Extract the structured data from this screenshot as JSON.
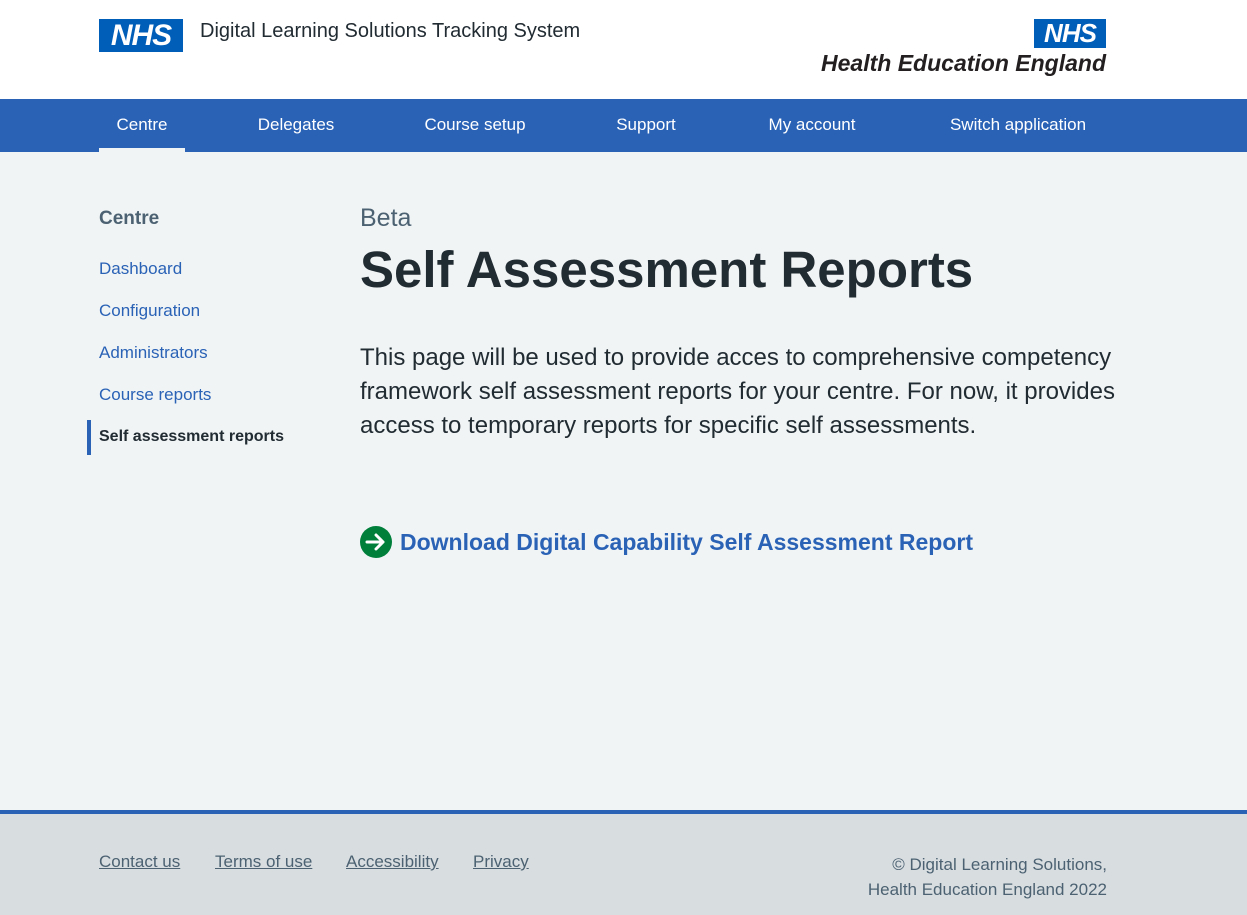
{
  "header": {
    "logo_text": "NHS",
    "service_name": "Digital Learning Solutions Tracking System",
    "partner_logo_badge": "NHS",
    "partner_logo_text": "Health Education England"
  },
  "nav": {
    "items": [
      {
        "label": "Centre",
        "active": true
      },
      {
        "label": "Delegates"
      },
      {
        "label": "Course setup"
      },
      {
        "label": "Support"
      },
      {
        "label": "My account"
      },
      {
        "label": "Switch application"
      }
    ]
  },
  "sidebar": {
    "heading": "Centre",
    "items": [
      {
        "label": "Dashboard"
      },
      {
        "label": "Configuration"
      },
      {
        "label": "Administrators"
      },
      {
        "label": "Course reports"
      },
      {
        "label": "Self assessment reports",
        "current": true
      }
    ]
  },
  "main": {
    "caption": "Beta",
    "title": "Self Assessment Reports",
    "body": "This page will be used to provide acces to comprehensive competency framework self assessment reports for your centre. For now, it provides access to temporary reports for specific self assessments.",
    "action_link": "Download Digital Capability Self Assessment Report",
    "action_icon": "arrow-right-circle-icon"
  },
  "footer": {
    "links": [
      {
        "label": "Contact us"
      },
      {
        "label": "Terms of use"
      },
      {
        "label": "Accessibility"
      },
      {
        "label": "Privacy"
      }
    ],
    "copyright_line1": "© Digital Learning Solutions,",
    "copyright_line2": "Health Education England 2022"
  },
  "colors": {
    "nhs_blue": "#005eb8",
    "nav_blue": "#2a62b6",
    "page_background": "#f0f4f5",
    "footer_background": "#d8dde0",
    "action_green": "#007f3b",
    "text_dark": "#212b32",
    "text_secondary": "#4c6272"
  }
}
